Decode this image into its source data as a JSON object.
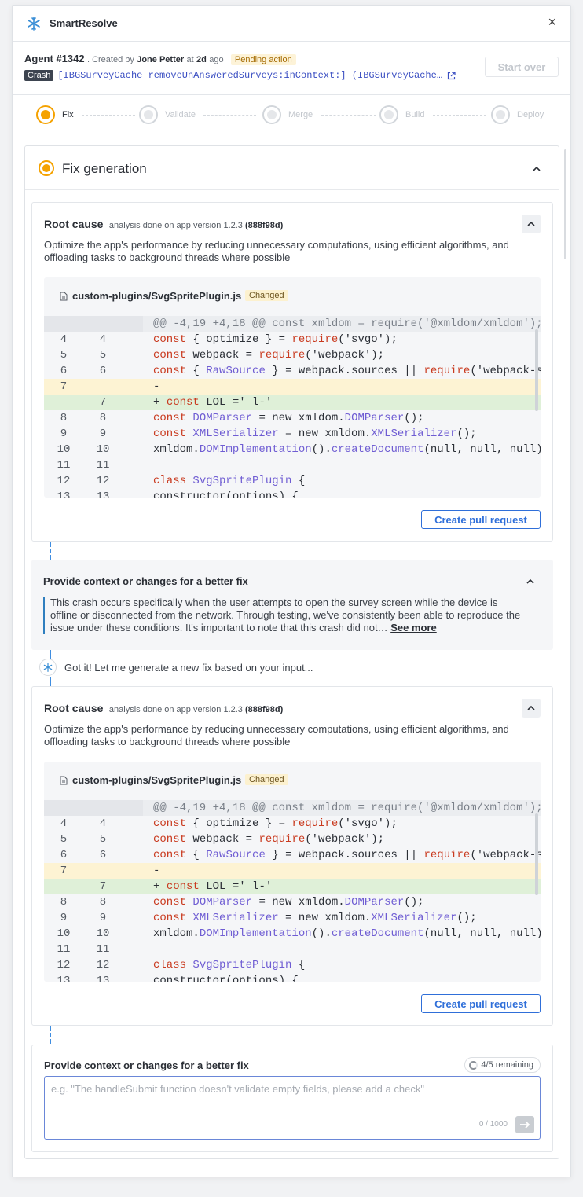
{
  "app": {
    "title": "SmartResolve"
  },
  "agent": {
    "id": "Agent #1342",
    "created_prefix": "Created by",
    "author": "Jone Petter",
    "at": "at",
    "age": "2d",
    "ago": "ago",
    "status": "Pending action",
    "crash_badge": "Crash",
    "crash_signature": "[IBGSurveyCache removeUnAnsweredSurveys:inContext:] (IBGSurveyCache…",
    "start_over": "Start over"
  },
  "steps": [
    {
      "label": "Fix",
      "active": true
    },
    {
      "label": "Validate",
      "active": false
    },
    {
      "label": "Merge",
      "active": false
    },
    {
      "label": "Build",
      "active": false
    },
    {
      "label": "Deploy",
      "active": false
    }
  ],
  "fix_section": {
    "title": "Fix generation"
  },
  "root_cause": {
    "title": "Root cause",
    "subtitle_prefix": "analysis done on app version 1.2.3",
    "commit": "(888f98d)",
    "description": "Optimize the app's performance by reducing unnecessary computations, using efficient algorithms, and offloading tasks to background threads where possible",
    "file": "custom-plugins/SvgSpritePlugin.js",
    "file_status": "Changed",
    "create_pr": "Create pull request",
    "diff": {
      "hunk": "@@ -4,19 +4,18 @@ const xmldom = require('@xmldom/xmldom');",
      "rows": [
        {
          "old": "4",
          "new": "4",
          "type": "ctx"
        },
        {
          "old": "5",
          "new": "5",
          "type": "ctx"
        },
        {
          "old": "6",
          "new": "6",
          "type": "ctx"
        },
        {
          "old": "7",
          "new": "",
          "type": "del"
        },
        {
          "old": "",
          "new": "7",
          "type": "add"
        },
        {
          "old": "8",
          "new": "8",
          "type": "ctx"
        },
        {
          "old": "9",
          "new": "9",
          "type": "ctx"
        },
        {
          "old": "10",
          "new": "10",
          "type": "ctx"
        },
        {
          "old": "11",
          "new": "11",
          "type": "ctx"
        },
        {
          "old": "12",
          "new": "12",
          "type": "ctx"
        },
        {
          "old": "13",
          "new": "13",
          "type": "ctx"
        }
      ]
    }
  },
  "context": {
    "title": "Provide context or changes for a better fix",
    "body": "This crash occurs specifically when the user attempts to open the survey screen while the device is offline or disconnected from the network. Through testing, we've consistently been able to reproduce the issue under these conditions. It's important to note that this crash did not…",
    "see_more": "See more"
  },
  "assistant_message": "Got it! Let me generate a new fix based on your input...",
  "input": {
    "title": "Provide context or changes for a better fix",
    "remaining": "4/5 remaining",
    "placeholder": "e.g. \"The handleSubmit function doesn't validate empty fields, please add a check\"",
    "counter": "0 / 1000"
  },
  "colors": {
    "accent": "#f5a200",
    "link": "#2f6fd9",
    "crash": "#3d4450"
  }
}
